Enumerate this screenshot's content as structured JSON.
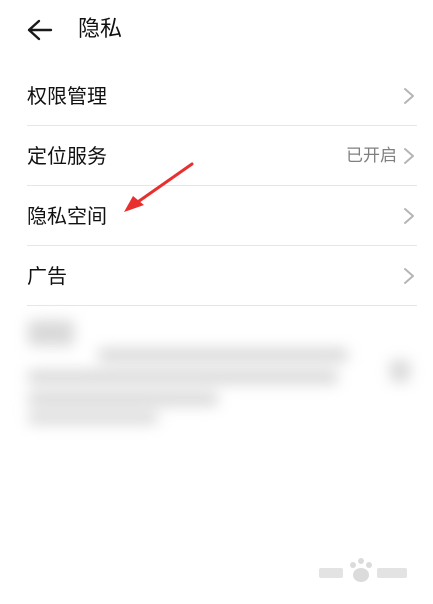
{
  "header": {
    "title": "隐私",
    "back_icon": "arrow-left-icon"
  },
  "list": {
    "items": [
      {
        "label": "权限管理",
        "value": "",
        "icon": "chevron-right-icon"
      },
      {
        "label": "定位服务",
        "value": "已开启",
        "icon": "chevron-right-icon"
      },
      {
        "label": "隐私空间",
        "value": "",
        "icon": "chevron-right-icon"
      },
      {
        "label": "广告",
        "value": "",
        "icon": "chevron-right-icon"
      }
    ]
  },
  "annotation": {
    "icon": "red-arrow-icon",
    "color": "#e8312f"
  },
  "colors": {
    "text_primary": "#111111",
    "text_secondary": "#7f7f7f",
    "divider": "#e6e6e6",
    "chevron": "#b5b5b5"
  }
}
